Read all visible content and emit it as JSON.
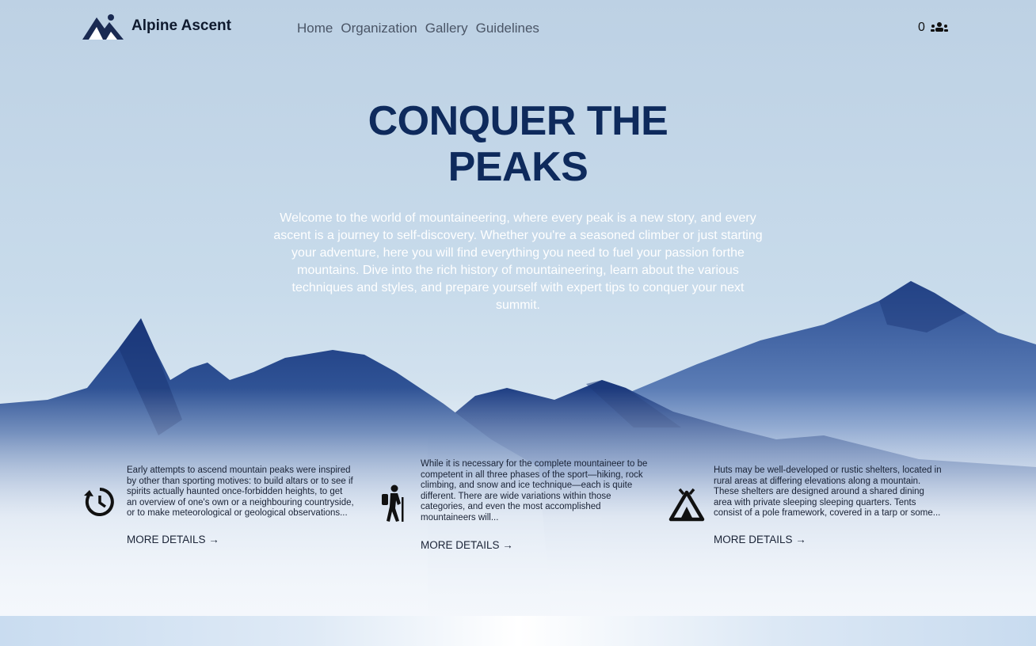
{
  "brand": {
    "name": "Alpine Ascent",
    "logo_icon": "mountain-logo-icon"
  },
  "nav": {
    "items": [
      {
        "label": "Home"
      },
      {
        "label": "Organization"
      },
      {
        "label": "Gallery"
      },
      {
        "label": "Guidelines"
      }
    ]
  },
  "header": {
    "count": "0",
    "count_icon": "users-icon"
  },
  "hero": {
    "title_line1": "CONQUER THE",
    "title_line2": "PEAKS",
    "lines": [
      "Welcome to the world of mountaineering, where every peak is a new story, and every",
      "ascent is a journey to self-discovery. Whether you're a seasoned climber or just starting",
      "your adventure, here you will find everything you need to fuel your passion forthe",
      "mountains. Dive into the rich history of mountaineering, learn about the various",
      "techniques and styles, and prepare yourself with expert tips to conquer your next",
      "summit."
    ]
  },
  "cards": [
    {
      "icon": "history-icon",
      "lines": [
        "Early attempts to ascend mountain peaks were inspired",
        "by other than sporting motives: to build altars or to see if",
        "spirits actually haunted once-forbidden heights, to get",
        "an overview of one's own or a neighbouring countryside,",
        "or to make meteorological or geological observations..."
      ],
      "more": "MORE DETAILS →"
    },
    {
      "icon": "hiker-icon",
      "lines": [
        "While it is necessary for the complete mountaineer to be",
        "competent in all three phases of the sport—hiking, rock",
        "climbing, and snow and ice technique—each is quite",
        "different. There are wide variations within those",
        "categories, and even the most accomplished",
        "mountaineers will..."
      ],
      "more": "MORE DETAILS →"
    },
    {
      "icon": "tent-icon",
      "lines": [
        "Huts may be well-developed or rustic shelters, located in",
        "rural areas at differing elevations along a mountain.",
        "These shelters are designed around a shared dining",
        "area with private sleeping sleeping quarters. Tents",
        "consist of a pole framework, covered in a tarp or some..."
      ],
      "more": "MORE DETAILS →"
    }
  ],
  "colors": {
    "title": "#0e2a5c",
    "mountain": "#1f3f86",
    "background": "#c3d6e8"
  }
}
